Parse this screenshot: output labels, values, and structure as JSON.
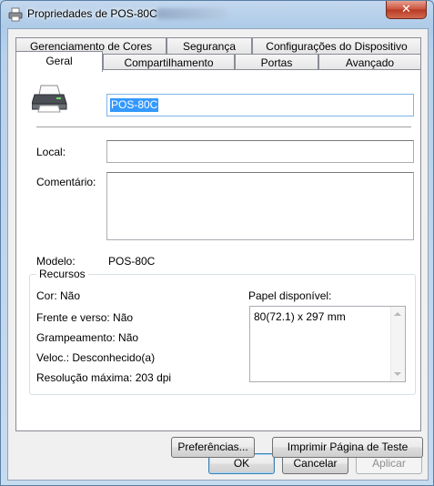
{
  "window": {
    "title": "Propriedades de POS-80C",
    "close_label": "✕"
  },
  "tabs": {
    "row1": [
      "Gerenciamento de Cores",
      "Segurança",
      "Configurações do Dispositivo"
    ],
    "row2": [
      "Geral",
      "Compartilhamento",
      "Portas",
      "Avançado"
    ],
    "active": "Geral"
  },
  "general": {
    "printer_name": "POS-80C",
    "location_label": "Local:",
    "location_value": "",
    "comment_label": "Comentário:",
    "comment_value": "",
    "model_label": "Modelo:",
    "model_value": "POS-80C"
  },
  "features": {
    "group_title": "Recursos",
    "color": "Cor: Não",
    "duplex": "Frente e verso: Não",
    "staple": "Grampeamento: Não",
    "speed": "Veloc.: Desconhecido(a)",
    "resolution": "Resolução máxima: 203 dpi",
    "paper_label": "Papel disponível:",
    "paper_items": [
      "80(72.1) x 297 mm"
    ]
  },
  "buttons": {
    "preferences": "Preferências...",
    "print_test": "Imprimir Página de Teste",
    "ok": "OK",
    "cancel": "Cancelar",
    "apply": "Aplicar"
  }
}
